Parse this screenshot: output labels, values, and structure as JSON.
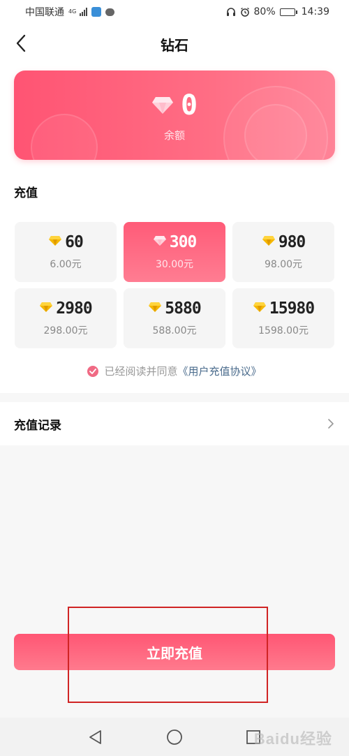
{
  "status_bar": {
    "carrier": "中国联通",
    "network": "4G",
    "battery": "80%",
    "battery_level": 0.8,
    "time": "14:39"
  },
  "header": {
    "title": "钻石"
  },
  "balance": {
    "value": "0",
    "label": "余额"
  },
  "recharge_section": {
    "title": "充值",
    "packages": [
      {
        "amount": "60",
        "price": "6.00元",
        "icon": "gold-diamond-icon",
        "selected": false
      },
      {
        "amount": "300",
        "price": "30.00元",
        "icon": "pink-diamond-icon",
        "selected": true
      },
      {
        "amount": "980",
        "price": "98.00元",
        "icon": "gold-diamond-icon",
        "selected": false
      },
      {
        "amount": "2980",
        "price": "298.00元",
        "icon": "gold-diamond-icon",
        "selected": false
      },
      {
        "amount": "5880",
        "price": "588.00元",
        "icon": "gold-diamond-icon",
        "selected": false
      },
      {
        "amount": "15980",
        "price": "1598.00元",
        "icon": "gold-diamond-icon",
        "selected": false
      }
    ]
  },
  "agreement": {
    "text": "已经阅读并同意",
    "link": "《用户充值协议》",
    "checked": true
  },
  "records": {
    "label": "充值记录"
  },
  "bottom": {
    "button_label": "立即充值"
  },
  "watermark": "Baidu经验",
  "colors": {
    "accent": "#ff5674",
    "card": "#ff6d84",
    "link": "#4a6b8c",
    "highlight": "#d02424",
    "gold": "#f5b700"
  }
}
